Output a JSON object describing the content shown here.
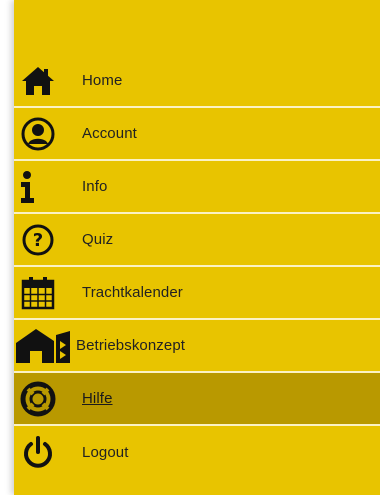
{
  "menu": {
    "items": [
      {
        "id": "home",
        "label": "Home",
        "icon": "home-icon"
      },
      {
        "id": "account",
        "label": "Account",
        "icon": "user-circle-icon"
      },
      {
        "id": "info",
        "label": "Info",
        "icon": "info-icon"
      },
      {
        "id": "quiz",
        "label": "Quiz",
        "icon": "question-circle-icon"
      },
      {
        "id": "trachtkalender",
        "label": "Trachtkalender",
        "icon": "calendar-icon"
      },
      {
        "id": "betriebskonzept",
        "label": "Betriebskonzept",
        "icon": "house-concept-icon"
      },
      {
        "id": "hilfe",
        "label": "Hilfe",
        "icon": "lifebuoy-icon",
        "active": true
      },
      {
        "id": "logout",
        "label": "Logout",
        "icon": "power-icon"
      }
    ]
  },
  "colors": {
    "panel": "#e8c400",
    "active_row": "#b99900",
    "separator": "#fbf2c4",
    "icon": "#111111"
  }
}
